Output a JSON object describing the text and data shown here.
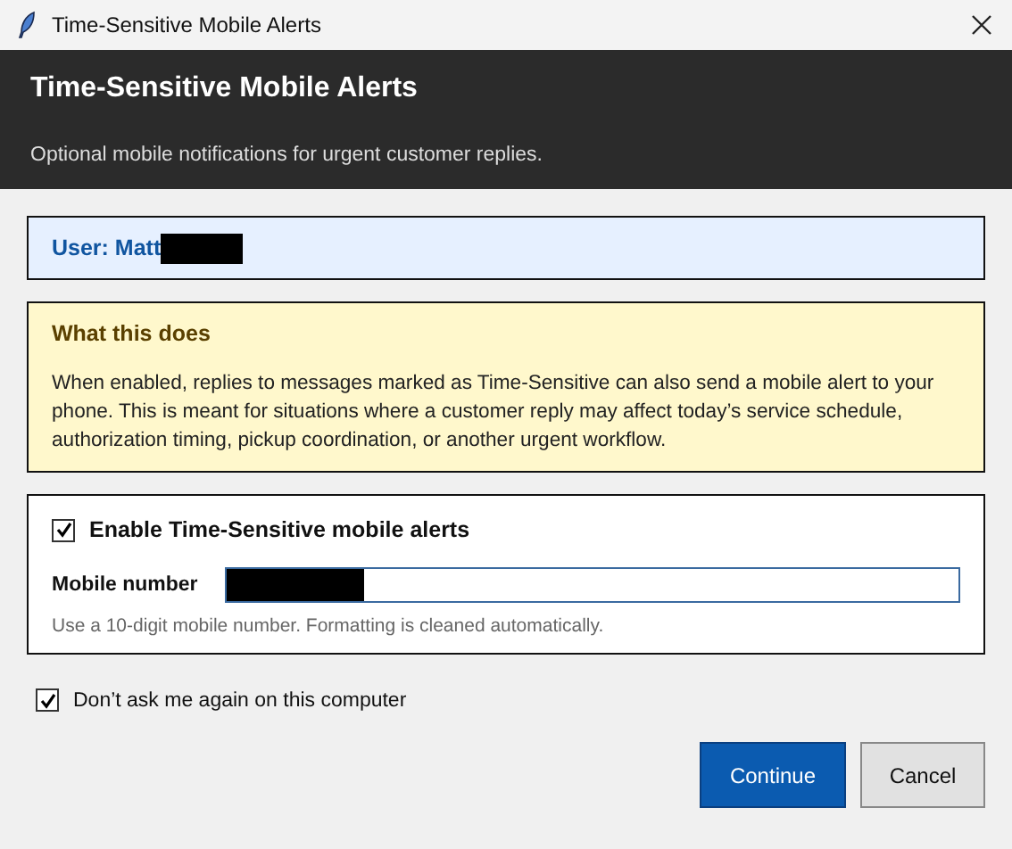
{
  "window": {
    "title": "Time-Sensitive Mobile Alerts"
  },
  "header": {
    "title": "Time-Sensitive Mobile Alerts",
    "subtitle": "Optional mobile notifications for urgent customer replies."
  },
  "user": {
    "label": "User: Matt"
  },
  "info": {
    "title": "What this does",
    "body": "When enabled, replies to messages marked as Time-Sensitive can also send a mobile alert to your phone. This is meant for situations where a customer reply may affect today’s service schedule, authorization timing, pickup coordination, or another urgent workflow."
  },
  "enable": {
    "label": "Enable Time-Sensitive mobile alerts",
    "checked": true
  },
  "mobile": {
    "label": "Mobile number",
    "hint": "Use a 10-digit mobile number. Formatting is cleaned automatically."
  },
  "dont_ask": {
    "label": "Don’t ask me again on this computer",
    "checked": true
  },
  "buttons": [
    {
      "label": "Continue",
      "kind": "primary"
    },
    {
      "label": "Cancel",
      "kind": "secondary"
    }
  ]
}
